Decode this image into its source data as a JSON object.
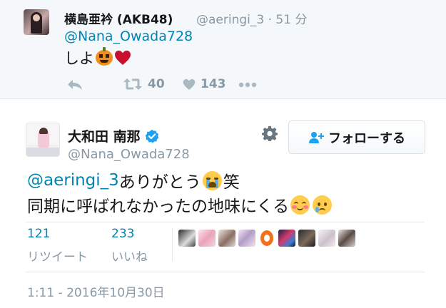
{
  "reply_tweet": {
    "author_name": "横島亜衿 (AKB48)",
    "handle_time": "@aeringi_3 · 51 分",
    "mention": "@Nana_Owada728",
    "text": "しよ",
    "emojis": [
      "pumpkin-emoji",
      "red-heart-emoji"
    ],
    "retweet_count": "40",
    "like_count": "143",
    "icons": [
      "reply-icon",
      "retweet-icon",
      "heart-icon",
      "more-icon"
    ]
  },
  "main_tweet": {
    "author_name": "大和田 南那",
    "handle": "@Nana_Owada728",
    "verified": true,
    "follow_button_label": "フォローする",
    "text_line1": {
      "mention": "@aeringi_3",
      "text_before_emoji": " ありがとう",
      "text_after_emoji": "笑"
    },
    "text_line2": {
      "text": "同期に呼ばれなかったの地味にくる"
    },
    "stats": {
      "retweets_count": "121",
      "retweets_label": "リツイート",
      "likes_count": "233",
      "likes_label": "いいね"
    },
    "likers_count": 9,
    "timestamp": "1:11 - 2016年10月30日"
  },
  "colors": {
    "link": "#0084b4",
    "secondary_text": "#8899a6",
    "reply_background": "#f5f8fa",
    "divider": "#e1e8ed",
    "verified": "#1da1f2",
    "heart": "#c8102e"
  }
}
